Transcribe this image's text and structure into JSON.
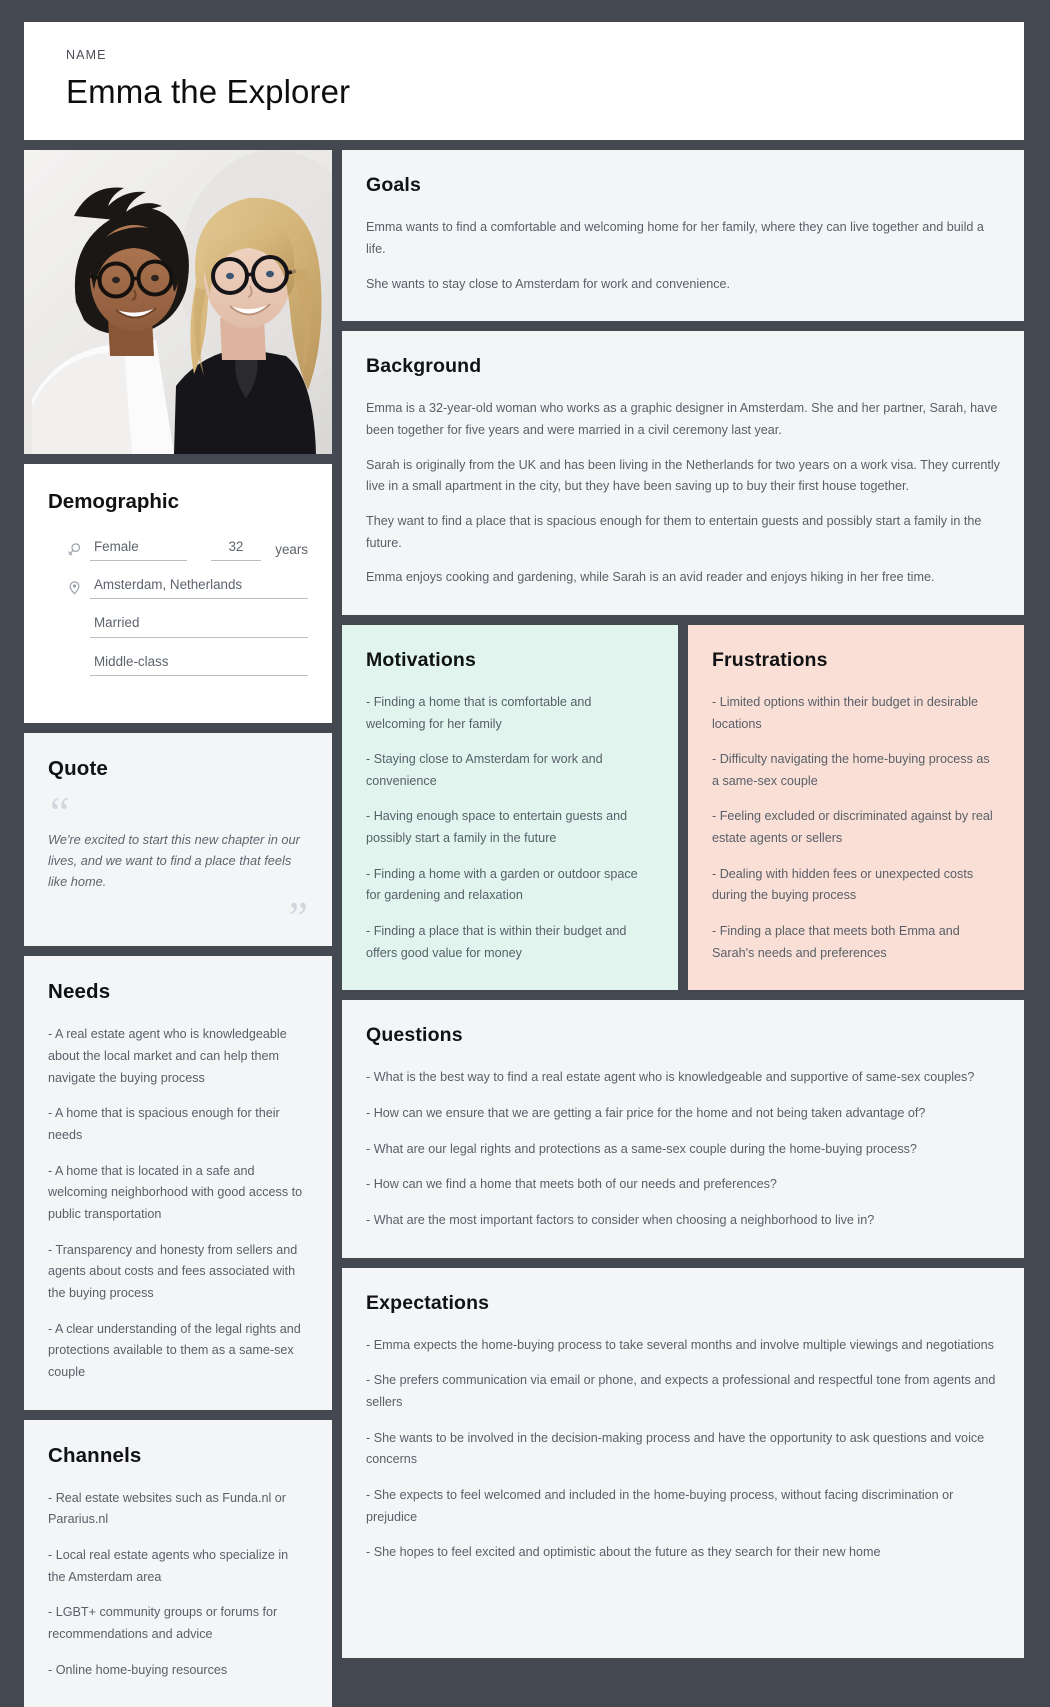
{
  "header": {
    "kicker": "NAME",
    "name": "Emma the Explorer"
  },
  "photo": {
    "alt": "Two smiling women embracing, both wearing glasses"
  },
  "demographic": {
    "title": "Demographic",
    "gender": "Female",
    "age": "32",
    "age_unit": "years",
    "location": "Amsterdam, Netherlands",
    "marital_status": "Married",
    "social_class": "Middle-class"
  },
  "quote": {
    "title": "Quote",
    "open_mark": "“",
    "close_mark": "”",
    "text": "We're excited to start this new chapter in our lives, and we want to find a place that feels like home."
  },
  "needs": {
    "title": "Needs",
    "items": [
      "- A real estate agent who is knowledgeable about the local market and can help them navigate the buying process",
      "- A home that is spacious enough for their needs",
      "- A home that is located in a safe and welcoming neighborhood with good access to public transportation",
      "- Transparency and honesty from sellers and agents about costs and fees associated with the buying process",
      "- A clear understanding of the legal rights and protections available to them as a same-sex couple"
    ]
  },
  "channels": {
    "title": "Channels",
    "items": [
      "- Real estate websites such as Funda.nl or Pararius.nl",
      "- Local real estate agents who specialize in the Amsterdam area",
      "- LGBT+ community groups or forums for recommendations and advice",
      "- Online home-buying resources"
    ]
  },
  "goals": {
    "title": "Goals",
    "paragraphs": [
      "Emma wants to find a comfortable and welcoming home for her family, where they can live together and build a life.",
      "She wants to stay close to Amsterdam for work and convenience."
    ]
  },
  "background": {
    "title": "Background",
    "paragraphs": [
      "Emma is a 32-year-old woman who works as a graphic designer in Amsterdam. She and her partner, Sarah, have been together for five years and were married in a civil ceremony last year.",
      "Sarah is originally from the UK and has been living in the Netherlands for two years on a work visa. They currently live in a small apartment in the city, but they have been saving up to buy their first house together.",
      "They want to find a place that is spacious enough for them to entertain guests and possibly start a family in the future.",
      "Emma enjoys cooking and gardening, while Sarah is an avid reader and enjoys hiking in her free time."
    ]
  },
  "motivations": {
    "title": "Motivations",
    "items": [
      "- Finding a home that is comfortable and welcoming for her family",
      "- Staying close to Amsterdam for work and convenience",
      "- Having enough space to entertain guests and possibly start a family in the future",
      "- Finding a home with a garden or outdoor space for gardening and relaxation",
      "- Finding a place that is within their budget and offers good value for money"
    ]
  },
  "frustrations": {
    "title": "Frustrations",
    "items": [
      "- Limited options within their budget in desirable locations",
      "- Difficulty navigating the home-buying process as a same-sex couple",
      "- Feeling excluded or discriminated against by real estate agents or sellers",
      "- Dealing with hidden fees or unexpected costs during the buying process",
      "- Finding a place that meets both Emma and Sarah's needs and preferences"
    ]
  },
  "questions": {
    "title": "Questions",
    "items": [
      "- What is the best way to find a real estate agent who is knowledgeable and supportive of same-sex couples?",
      "- How can we ensure that we are getting a fair price for the home and not being taken advantage of?",
      "- What are our legal rights and protections as a same-sex couple during the home-buying process?",
      "- How can we find a home that meets both of our needs and preferences?",
      "- What are the most important factors to consider when choosing a neighborhood to live in?"
    ]
  },
  "expectations": {
    "title": "Expectations",
    "items": [
      "- Emma expects the home-buying process to take several months and involve multiple viewings and negotiations",
      "- She prefers communication via email or phone, and expects a professional and respectful tone from agents and sellers",
      "- She wants to be involved in the decision-making process and have the opportunity to ask questions and voice concerns",
      "- She expects to feel welcomed and included in the home-buying process, without facing discrimination or prejudice",
      "- She hopes to feel excited and optimistic about the future as they search for their new home"
    ]
  },
  "colors": {
    "page_background": "#434851",
    "card_background": "#f4f5f7",
    "header_background": "#ffffff",
    "motivations_background": "#e1f5ee",
    "frustrations_background": "#fadfd6",
    "heading_text": "#111213",
    "body_text": "#595f68"
  }
}
